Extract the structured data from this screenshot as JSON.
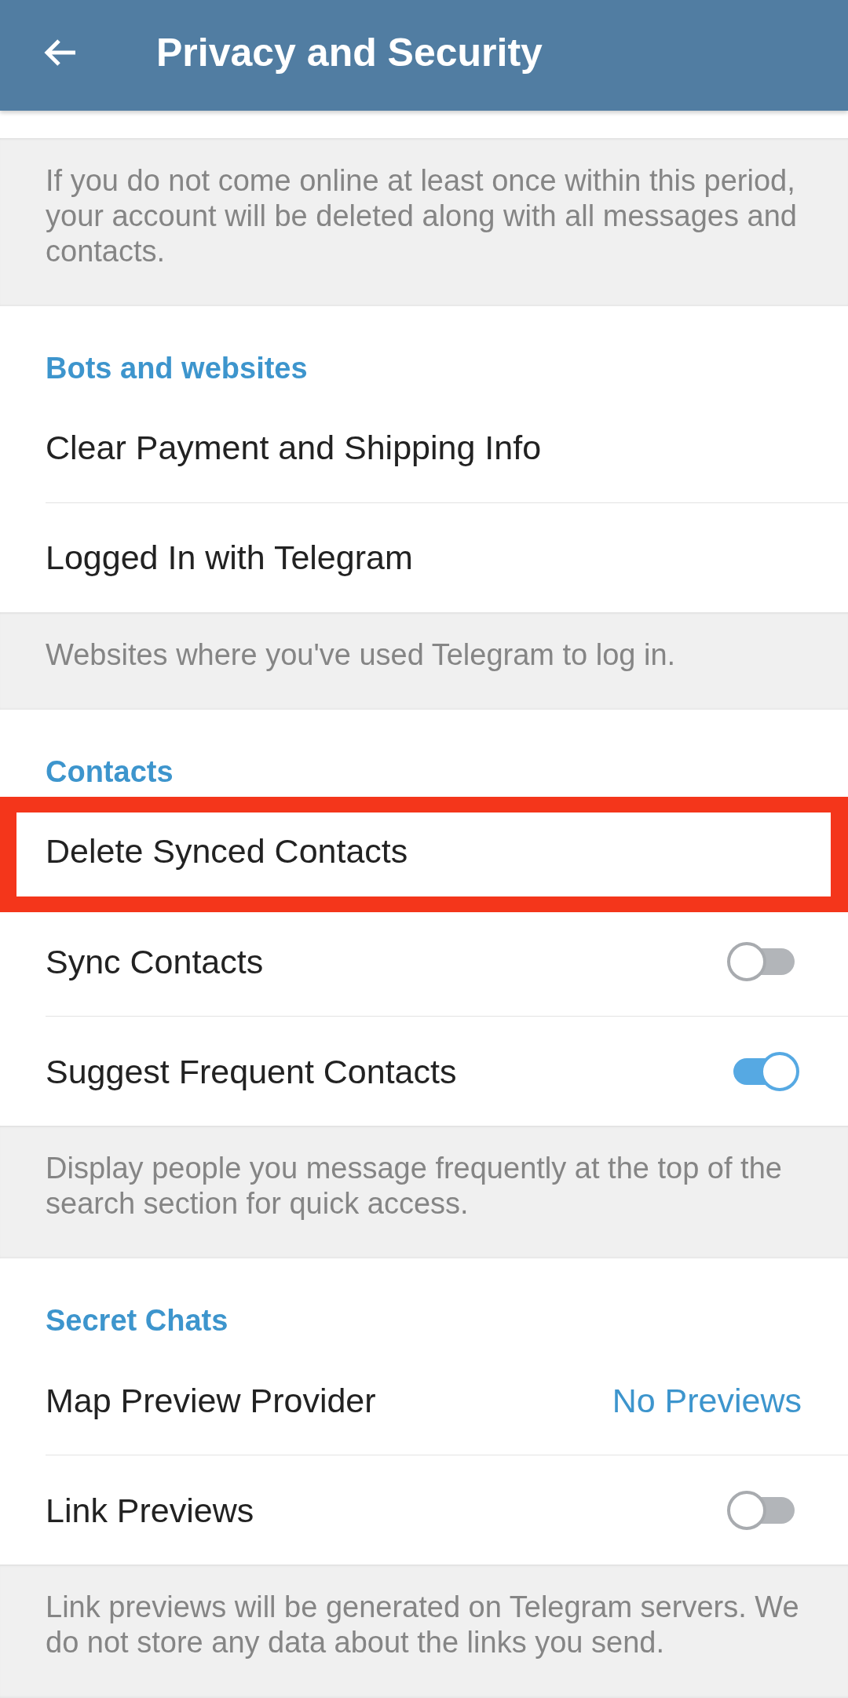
{
  "app_bar": {
    "title": "Privacy and Security"
  },
  "blocks": [
    {
      "kind": "note",
      "text": "If you do not come online at least once within this period, your account will be deleted along with all messages and contacts."
    },
    {
      "kind": "section",
      "title": "Bots and websites",
      "items": [
        {
          "kind": "action",
          "label": "Clear Payment and Shipping Info",
          "highlighted": false
        },
        {
          "kind": "action",
          "label": "Logged In with Telegram",
          "highlighted": false
        }
      ]
    },
    {
      "kind": "note",
      "text": "Websites where you've used Telegram to log in."
    },
    {
      "kind": "section",
      "title": "Contacts",
      "items": [
        {
          "kind": "action",
          "label": "Delete Synced Contacts",
          "highlighted": true
        },
        {
          "kind": "toggle",
          "label": "Sync Contacts",
          "on": false,
          "highlighted": false
        },
        {
          "kind": "toggle",
          "label": "Suggest Frequent Contacts",
          "on": true,
          "highlighted": false
        }
      ]
    },
    {
      "kind": "note",
      "text": "Display people you message frequently at the top of the search section for quick access."
    },
    {
      "kind": "section",
      "title": "Secret Chats",
      "items": [
        {
          "kind": "value",
          "label": "Map Preview Provider",
          "value": "No Previews",
          "highlighted": false
        },
        {
          "kind": "toggle",
          "label": "Link Previews",
          "on": false,
          "highlighted": false
        }
      ]
    },
    {
      "kind": "note",
      "text": "Link previews will be generated on Telegram servers. We do not store any data about the links you send."
    }
  ]
}
